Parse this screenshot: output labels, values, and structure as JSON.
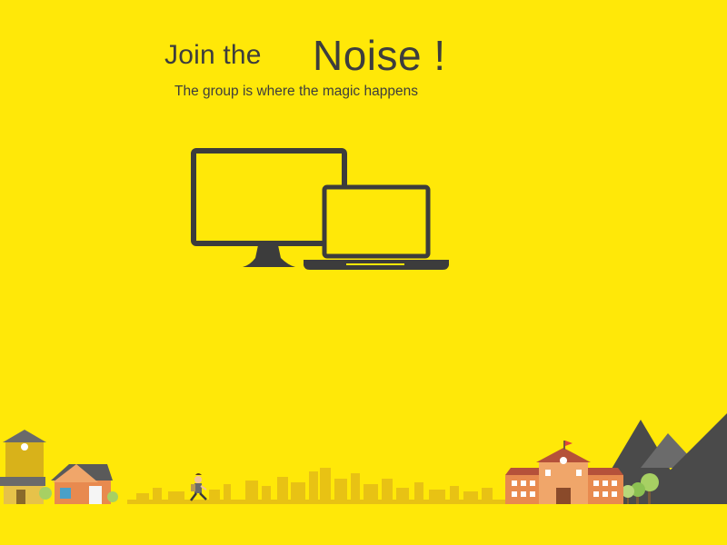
{
  "headline": {
    "lead": "Join the",
    "emphasis": "Noise !",
    "tagline": "The group is where the magic happens"
  },
  "colors": {
    "background": "#FFE808",
    "text": "#3d3d3d",
    "device": "#3c3c3c",
    "skyline": "#E8C214",
    "mountain_dark": "#4a4a4a",
    "mountain_light": "#6b6b6b"
  },
  "icons": [
    "desktop-monitor-icon",
    "laptop-icon"
  ],
  "scene": [
    "tower-house",
    "orange-house",
    "running-person",
    "city-skyline",
    "school-building",
    "trees",
    "mountains"
  ]
}
